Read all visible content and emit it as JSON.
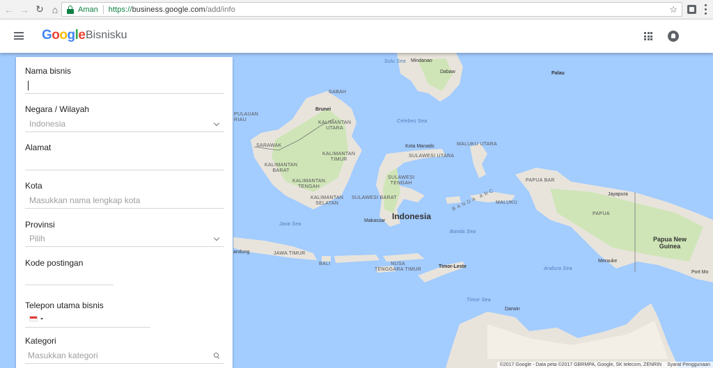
{
  "browser": {
    "secure_label": "Aman",
    "url_scheme": "https://",
    "url_host": "business.google.com",
    "url_path": "/add/info"
  },
  "app": {
    "product_name": "Bisnisku",
    "logo_letters": [
      {
        "char": "G",
        "color": "#4285f4"
      },
      {
        "char": "o",
        "color": "#ea4335"
      },
      {
        "char": "o",
        "color": "#fbbc05"
      },
      {
        "char": "g",
        "color": "#4285f4"
      },
      {
        "char": "l",
        "color": "#34a853"
      },
      {
        "char": "e",
        "color": "#ea4335"
      }
    ]
  },
  "form": {
    "business_name_label": "Nama bisnis",
    "business_name_value": "",
    "country_label": "Negara / Wilayah",
    "country_value": "Indonesia",
    "address_label": "Alamat",
    "address_value": "",
    "city_label": "Kota",
    "city_placeholder": "Masukkan nama lengkap kota",
    "province_label": "Provinsi",
    "province_value": "Pilih",
    "postal_label": "Kode postingan",
    "phone_label": "Telepon utama bisnis",
    "category_label": "Kategori",
    "category_placeholder": "Masukkan kategori"
  },
  "map": {
    "labels": {
      "sulu_sea": "Sulu Sea",
      "mindanao": "Mindanao",
      "dabaw": "Dabaw",
      "palau": "Palau",
      "sabah": "SABAH",
      "pulauan": "PULAUAN",
      "riau": "RIAU",
      "brunei": "Brunei",
      "kalimantan_utara": "KALIMANTAN\nUTARA",
      "celebes_sea": "Celebes Sea",
      "sarawak": "SARAWAK",
      "kalimantan_timur": "KALIMANTAN\nTIMUR",
      "kota_manado": "Kota Manado",
      "maluku_utara": "MALUKU UTARA",
      "kalimantan_barat": "KALIMANTAN\nBARAT",
      "sulawesi_utara": "SULAWESI UTARA",
      "kalimantan_tengah": "KALIMANTAN\nTENGAH",
      "sulawesi_tengah": "SULAWESI\nTENGAH",
      "banda_arc": "BANDA ARC",
      "papua_bar": "PAPUA BAR",
      "jayapura": "Jayapura",
      "kalimantan_selatan": "KALIMANTAN\nSELATAN",
      "sulawesi_barat": "SULAWESI BARAT",
      "maluku": "MALUKU",
      "papua": "PAPUA",
      "makassar": "Makassar",
      "indonesia": "Indonesia",
      "java_sea": "Java Sea",
      "banda_sea": "Banda Sea",
      "papua_new_guinea": "Papua New\nGuinea",
      "andung": "andung",
      "jawa_timur": "JAWA TIMUR",
      "bali": "BALI",
      "nusa_tenggara_timur": "NUSA\nTENGGARA TIMUR",
      "timor_leste": "Timor-Leste",
      "merauke": "Merauke",
      "arafura_sea": "Arafura Sea",
      "port_mo": "Port Mo",
      "timor_sea": "Timor Sea",
      "darwin": "Darwin"
    },
    "attribution": "©2017 Google - Data peta ©2017 GBRMPA, Google, SK telecom, ZENRIN",
    "terms": "Syarat Penggunaan"
  },
  "colors": {
    "water": "#a3ccff",
    "land": "#e8e4dc",
    "forest": "#cfe5b7",
    "secure_green": "#0b8043"
  }
}
